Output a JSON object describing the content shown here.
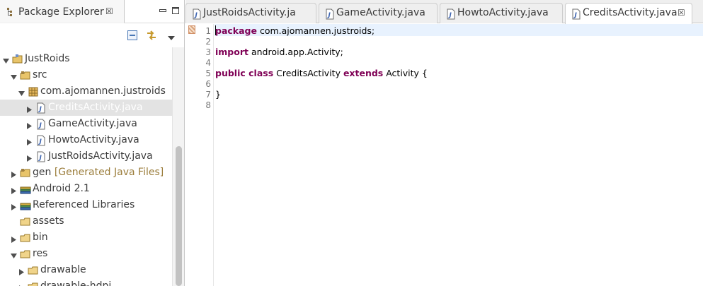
{
  "explorer": {
    "title": "Package Explorer",
    "close_glyph": "☒",
    "toolbar_icons": [
      "collapse-all-icon",
      "link-with-editor-icon",
      "view-menu-icon"
    ],
    "tree": [
      {
        "label": "JustRoids",
        "icon": "project-icon",
        "expanded": true
      },
      {
        "label": "src",
        "icon": "source-folder-icon",
        "expanded": true
      },
      {
        "label": "com.ajomannen.justroids",
        "icon": "package-icon",
        "expanded": true
      },
      {
        "label": "CreditsActivity.java",
        "icon": "java-file-icon",
        "expanded": false,
        "selected": true
      },
      {
        "label": "GameActivity.java",
        "icon": "java-file-icon",
        "expanded": false
      },
      {
        "label": "HowtoActivity.java",
        "icon": "java-file-icon",
        "expanded": false
      },
      {
        "label": "JustRoidsActivity.java",
        "icon": "java-file-icon",
        "expanded": false
      },
      {
        "label": "gen",
        "decoration": "[Generated Java Files]",
        "icon": "generated-folder-icon",
        "expanded": false
      },
      {
        "label": "Android 2.1",
        "icon": "library-icon",
        "expanded": false
      },
      {
        "label": "Referenced Libraries",
        "icon": "library-icon",
        "expanded": false
      },
      {
        "label": "assets",
        "icon": "folder-icon"
      },
      {
        "label": "bin",
        "icon": "folder-icon",
        "expanded": false
      },
      {
        "label": "res",
        "icon": "folder-icon",
        "expanded": true
      },
      {
        "label": "drawable",
        "icon": "folder-icon",
        "expanded": false
      },
      {
        "label": "drawable-hdpi",
        "icon": "folder-icon",
        "expanded": false
      }
    ]
  },
  "editor": {
    "tabs": [
      {
        "label": "JustRoidsActivity.ja",
        "active": false
      },
      {
        "label": "GameActivity.java",
        "active": false
      },
      {
        "label": "HowtoActivity.java",
        "active": false
      },
      {
        "label": "CreditsActivity.java",
        "active": true
      }
    ],
    "tab_close_glyph": "☒",
    "line_numbers": [
      "1",
      "2",
      "3",
      "4",
      "5",
      "6",
      "7",
      "8"
    ],
    "lines": [
      {
        "kw": "package",
        "rest": " com.ajomannen.justroids;"
      },
      {
        "kw": "",
        "rest": ""
      },
      {
        "kw": "import",
        "rest": " android.app.Activity;"
      },
      {
        "kw": "",
        "rest": ""
      },
      {
        "kw": "public class",
        "rest": " CreditsActivity ",
        "kw2": "extends",
        "rest2": " Activity {"
      },
      {
        "kw": "",
        "rest": ""
      },
      {
        "kw": "",
        "rest": "}"
      },
      {
        "kw": "",
        "rest": ""
      }
    ]
  },
  "colors": {
    "keyword": "#7f0055",
    "current_line": "#e8f2fe",
    "selection": "#e3e3e3",
    "decoration": "#9b7d3b"
  }
}
